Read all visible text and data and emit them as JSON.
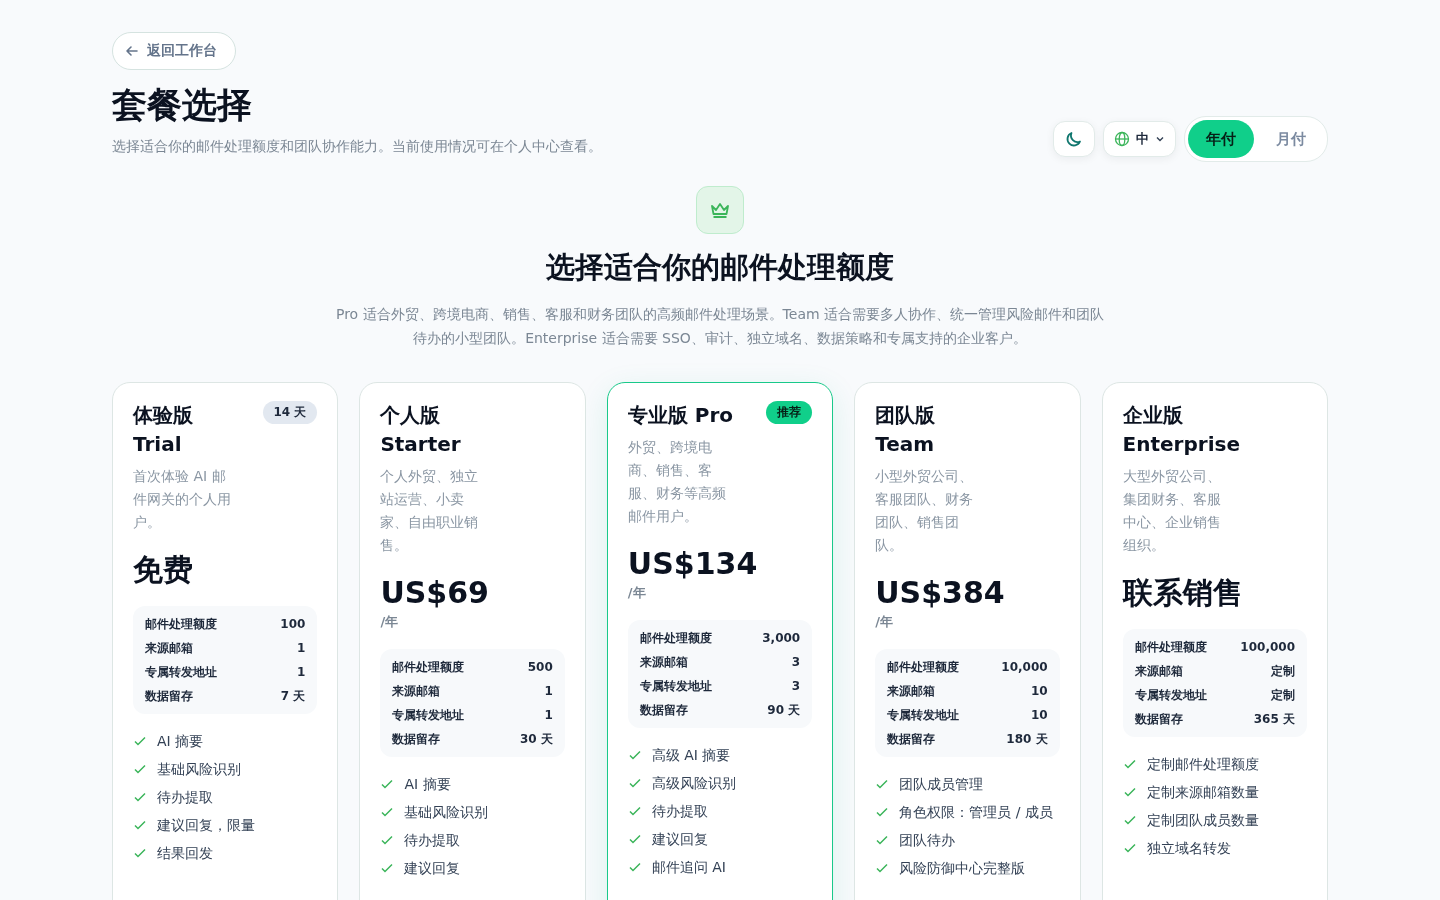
{
  "back_button": {
    "label": "返回工作台"
  },
  "page_title": "套餐选择",
  "page_subtitle": "选择适合你的邮件处理额度和团队协作能力。当前使用情况可在个人中心查看。",
  "toolbar": {
    "language": "中",
    "billing_tabs": [
      {
        "label": "年付",
        "selected": true
      },
      {
        "label": "月付",
        "selected": false
      }
    ]
  },
  "hero": {
    "title": "选择适合你的邮件处理额度",
    "description": "Pro 适合外贸、跨境电商、销售、客服和财务团队的高频邮件处理场景。Team 适合需要多人协作、统一管理风险邮件和团队待办的小型团队。Enterprise 适合需要 SSO、审计、独立域名、数据策略和专属支持的企业客户。"
  },
  "plans": [
    {
      "title_lines": [
        "体验版",
        "Trial"
      ],
      "badge": {
        "kind": "neutral",
        "label": "14 天"
      },
      "featured": false,
      "description": "首次体验 AI 邮件网关的个人用户。",
      "price": "免费",
      "quota": [
        {
          "label": "邮件处理额度",
          "value": "100"
        },
        {
          "label": "来源邮箱",
          "value": "1"
        },
        {
          "label": "专属转发地址",
          "value": "1"
        },
        {
          "label": "数据留存",
          "value": "7 天"
        }
      ],
      "features": [
        "AI 摘要",
        "基础风险识别",
        "待办提取",
        "建议回复，限量",
        "结果回发"
      ]
    },
    {
      "title_lines": [
        "个人版",
        "Starter"
      ],
      "featured": false,
      "description": "个人外贸、独立站运营、小卖家、自由职业销售。",
      "price": "US$69",
      "period": "/年",
      "quota": [
        {
          "label": "邮件处理额度",
          "value": "500"
        },
        {
          "label": "来源邮箱",
          "value": "1"
        },
        {
          "label": "专属转发地址",
          "value": "1"
        },
        {
          "label": "数据留存",
          "value": "30 天"
        }
      ],
      "features": [
        "AI 摘要",
        "基础风险识别",
        "待办提取",
        "建议回复"
      ]
    },
    {
      "title_lines": [
        "专业版 Pro"
      ],
      "badge": {
        "kind": "recommended",
        "label": "推荐"
      },
      "featured": true,
      "description": "外贸、跨境电商、销售、客服、财务等高频邮件用户。",
      "price": "US$134",
      "period": "/年",
      "quota": [
        {
          "label": "邮件处理额度",
          "value": "3,000"
        },
        {
          "label": "来源邮箱",
          "value": "3"
        },
        {
          "label": "专属转发地址",
          "value": "3"
        },
        {
          "label": "数据留存",
          "value": "90 天"
        }
      ],
      "features": [
        "高级 AI 摘要",
        "高级风险识别",
        "待办提取",
        "建议回复",
        "邮件追问 AI"
      ]
    },
    {
      "title_lines": [
        "团队版",
        "Team"
      ],
      "featured": false,
      "description": "小型外贸公司、客服团队、财务团队、销售团队。",
      "price": "US$384",
      "period": "/年",
      "quota": [
        {
          "label": "邮件处理额度",
          "value": "10,000"
        },
        {
          "label": "来源邮箱",
          "value": "10"
        },
        {
          "label": "专属转发地址",
          "value": "10"
        },
        {
          "label": "数据留存",
          "value": "180 天"
        }
      ],
      "features": [
        "团队成员管理",
        "角色权限：管理员 / 成员",
        "团队待办",
        "风险防御中心完整版"
      ]
    },
    {
      "title_lines": [
        "企业版",
        "Enterprise"
      ],
      "featured": false,
      "description": "大型外贸公司、集团财务、客服中心、企业销售组织。",
      "price": "联系销售",
      "quota": [
        {
          "label": "邮件处理额度",
          "value": "100,000"
        },
        {
          "label": "来源邮箱",
          "value": "定制"
        },
        {
          "label": "专属转发地址",
          "value": "定制"
        },
        {
          "label": "数据留存",
          "value": "365 天"
        }
      ],
      "features": [
        "定制邮件处理额度",
        "定制来源邮箱数量",
        "定制团队成员数量",
        "独立域名转发"
      ]
    }
  ]
}
